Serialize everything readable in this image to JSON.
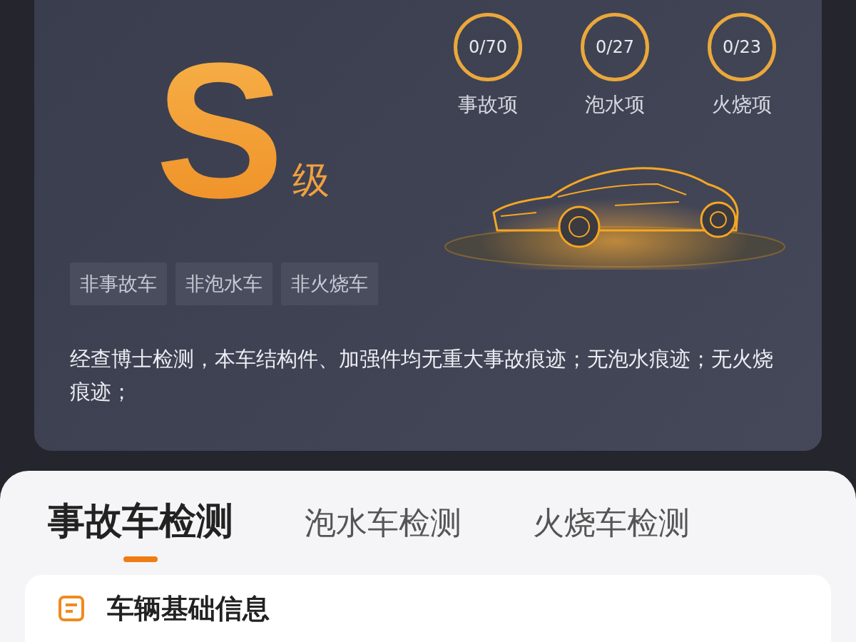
{
  "report": {
    "grade": "S",
    "grade_suffix": "级",
    "counters": [
      {
        "value": "0/70",
        "label": "事故项"
      },
      {
        "value": "0/27",
        "label": "泡水项"
      },
      {
        "value": "0/23",
        "label": "火烧项"
      }
    ],
    "tags": [
      "非事故车",
      "非泡水车",
      "非火烧车"
    ],
    "description": "经查博士检测，本车结构件、加强件均无重大事故痕迹；无泡水痕迹；无火烧痕迹；"
  },
  "tabs": [
    {
      "label": "事故车检测",
      "selected": true
    },
    {
      "label": "泡水车检测",
      "selected": false
    },
    {
      "label": "火烧车检测",
      "selected": false
    }
  ],
  "section": {
    "title": "车辆基础信息"
  }
}
